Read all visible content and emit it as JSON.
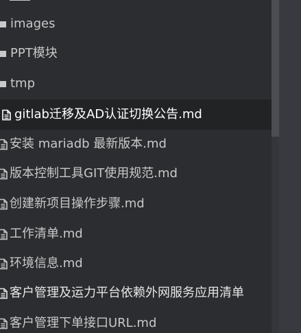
{
  "file_tree": {
    "items": [
      {
        "kind": "folder",
        "label": "images",
        "active": false
      },
      {
        "kind": "folder",
        "label": "PPT模块",
        "active": false
      },
      {
        "kind": "folder",
        "label": "tmp",
        "active": false
      },
      {
        "kind": "file",
        "label": "gitlab迁移及AD认证切换公告.md",
        "active": true
      },
      {
        "kind": "file",
        "label": "安装 mariadb 最新版本.md",
        "active": false
      },
      {
        "kind": "file",
        "label": "版本控制工具GIT使用规范.md",
        "active": false
      },
      {
        "kind": "file",
        "label": "创建新项目操作步骤.md",
        "active": false
      },
      {
        "kind": "file",
        "label": "工作清单.md",
        "active": false
      },
      {
        "kind": "file",
        "label": "环境信息.md",
        "active": false
      },
      {
        "kind": "file",
        "label": "客户管理及运力平台依赖外网服务应用清单",
        "active": false
      },
      {
        "kind": "file",
        "label": "客户管理下单接口URL.md",
        "active": false
      }
    ]
  },
  "icons": {
    "folder": "folder-icon",
    "file": "file-document-icon"
  },
  "colors": {
    "sidebar_bg": "#2c2d30",
    "active_row_bg": "#222325",
    "text": "#c9c9c9",
    "active_text": "#ffffff"
  }
}
